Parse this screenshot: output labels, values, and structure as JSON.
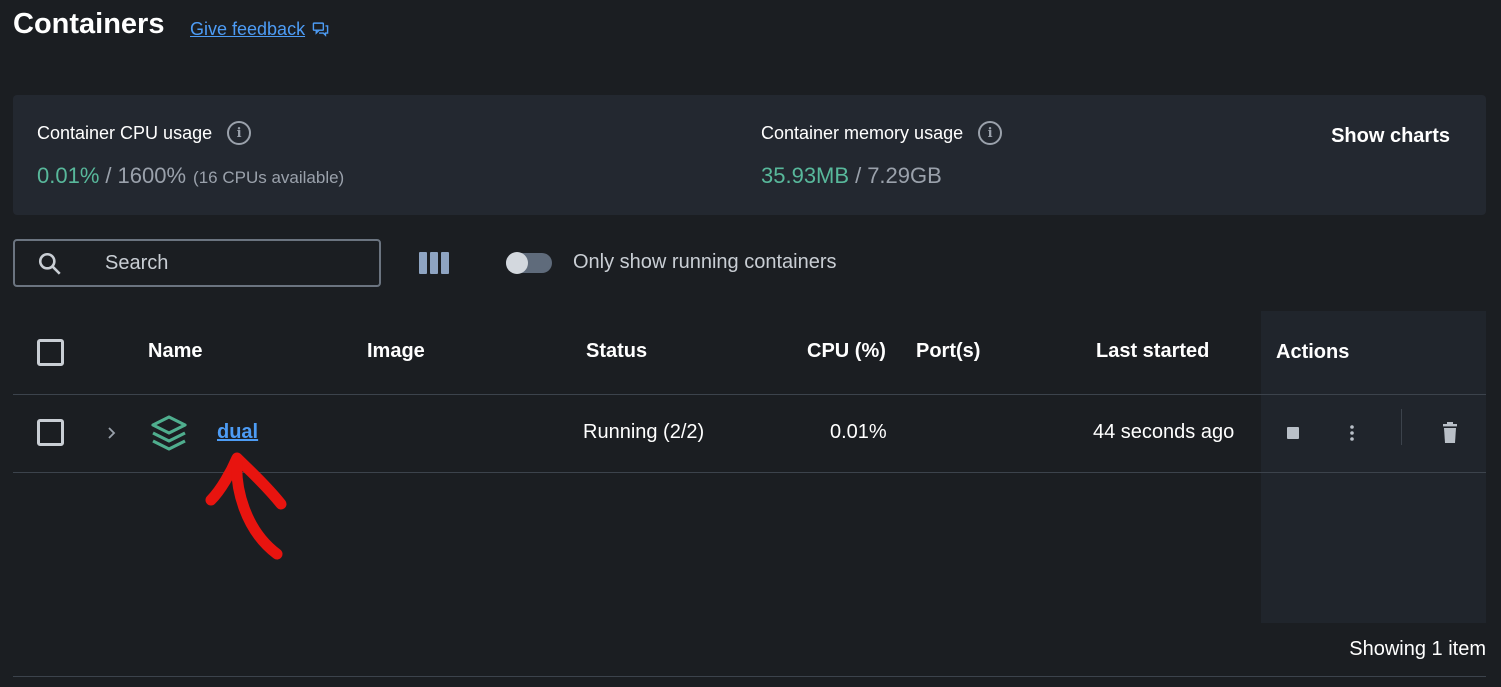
{
  "header": {
    "title": "Containers",
    "feedback_label": "Give feedback"
  },
  "stats": {
    "cpu": {
      "label": "Container CPU usage",
      "used": "0.01%",
      "separator": "/",
      "total": "1600%",
      "note": "(16 CPUs available)"
    },
    "memory": {
      "label": "Container memory usage",
      "used": "35.93MB",
      "separator": "/",
      "total": "7.29GB"
    },
    "show_charts_label": "Show charts",
    "accent_color": "#58b89b"
  },
  "toolbar": {
    "search_placeholder": "Search",
    "toggle_label": "Only show running containers",
    "toggle_on": false
  },
  "table": {
    "columns": {
      "name": "Name",
      "image": "Image",
      "status": "Status",
      "cpu": "CPU (%)",
      "ports": "Port(s)",
      "last_started": "Last started",
      "actions": "Actions"
    },
    "rows": [
      {
        "name": "dual",
        "image": "",
        "status": "Running (2/2)",
        "cpu": "0.01%",
        "ports": "",
        "last_started": "44 seconds ago",
        "icon": "stack-icon"
      }
    ],
    "footer": "Showing 1 item"
  },
  "colors": {
    "background": "#1b1e22",
    "panel": "#232830",
    "link": "#4d9cf5",
    "annotation": "#e8140f"
  }
}
